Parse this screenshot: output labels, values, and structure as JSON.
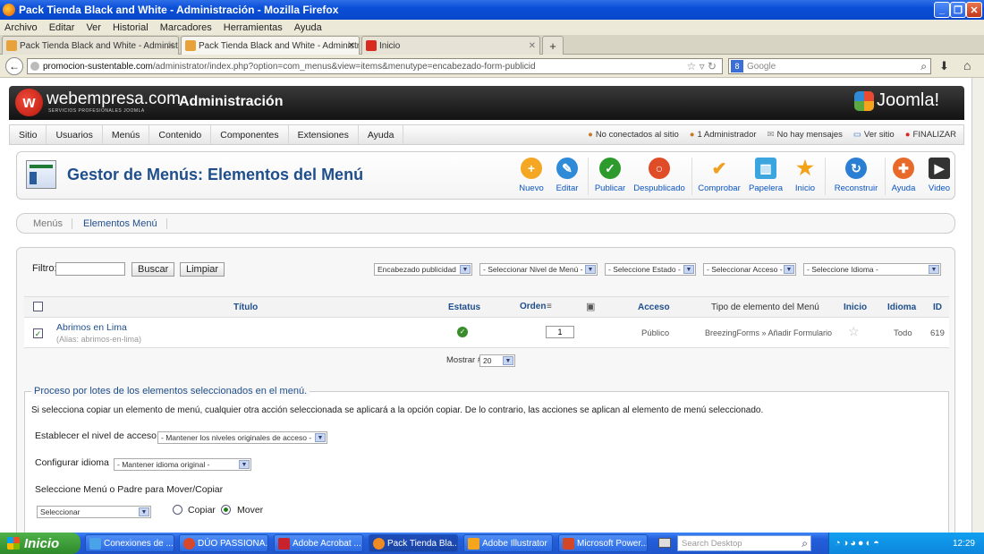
{
  "window": {
    "title": "Pack Tienda Black and White - Administración - Mozilla Firefox"
  },
  "menubar": [
    "Archivo",
    "Editar",
    "Ver",
    "Historial",
    "Marcadores",
    "Herramientas",
    "Ayuda"
  ],
  "tabs": [
    {
      "label": "Pack Tienda Black and White - Administra...",
      "active": false
    },
    {
      "label": "Pack Tienda Black and White - Administra...",
      "active": true
    },
    {
      "label": "Inicio",
      "active": false
    }
  ],
  "nav": {
    "url_domain": "promocion-sustentable.com",
    "url_path": "/administrator/index.php?option=com_menus&view=items&menutype=encabezado-form-publicid",
    "search_placeholder": "Google"
  },
  "joomla": {
    "brand": "webempresa.com",
    "brand_tagline": "SERVICIOS PROFESIONALES JOOMLA",
    "admin_title": "Administración",
    "joomla_logo": "Joomla!",
    "main_menu": [
      "Sitio",
      "Usuarios",
      "Menús",
      "Contenido",
      "Componentes",
      "Extensiones",
      "Ayuda"
    ],
    "status": {
      "not_connected": "No conectados al sitio",
      "admin": "1 Administrador",
      "messages": "No hay mensajes",
      "view_site": "Ver sitio",
      "logout": "FINALIZAR"
    },
    "page_title": "Gestor de Menús: Elementos del Menú",
    "toolbar": [
      {
        "label": "Nuevo",
        "color": "#f5a623",
        "icon": "plus-icon"
      },
      {
        "label": "Editar",
        "color": "#2f8ad8",
        "icon": "pencil-icon"
      },
      {
        "label": "Publicar",
        "color": "#2d9a2d",
        "icon": "check-icon"
      },
      {
        "label": "Despublicado",
        "color": "#e04b28",
        "icon": "unpublish-icon"
      },
      {
        "label": "Comprobar",
        "color": "#f0a020",
        "icon": "checkmark-icon"
      },
      {
        "label": "Papelera",
        "color": "#3ba5e0",
        "icon": "trash-icon"
      },
      {
        "label": "Inicio",
        "color": "#f2a319",
        "icon": "star-icon"
      },
      {
        "label": "Reconstruir",
        "color": "#2a7fd4",
        "icon": "refresh-icon"
      },
      {
        "label": "Ayuda",
        "color": "#e86a2b",
        "icon": "help-icon"
      },
      {
        "label": "Video",
        "color": "#333333",
        "icon": "video-icon"
      }
    ],
    "submenu": [
      "Menús",
      "Elementos Menú"
    ],
    "filter": {
      "label": "Filtro:",
      "value": "",
      "search_btn": "Buscar",
      "clear_btn": "Limpiar",
      "menu_select": "Encabezado publicidad",
      "level_select": "- Seleccionar Nivel de Menú -",
      "state_select": "- Seleccione Estado -",
      "access_select": "- Seleccionar Acceso -",
      "lang_select": "- Seleccione Idioma -"
    },
    "table": {
      "headers": {
        "title": "Título",
        "status": "Estatus",
        "order": "Orden",
        "access": "Acceso",
        "type": "Tipo de elemento del Menú",
        "home": "Inicio",
        "lang": "Idioma",
        "id": "ID"
      },
      "rows": [
        {
          "title": "Abrimos en Lima",
          "alias": "(Alias: abrimos-en-lima)",
          "order": "1",
          "access": "Público",
          "type": "BreezingForms » Añadir Formulario",
          "lang": "Todo",
          "id": "619"
        }
      ],
      "show_label": "Mostrar #",
      "show_value": "20"
    },
    "batch": {
      "legend": "Proceso por lotes de los elementos seleccionados en el menú.",
      "tip": "Si selecciona copiar un elemento de menú, cualquier otra acción seleccionada se aplicará a la opción copiar. De lo contrario, las acciones se aplican al elemento de menú seleccionado.",
      "access_label": "Establecer el nivel de acceso",
      "access_value": "- Mantener los niveles originales de acceso -",
      "lang_label": "Configurar idioma",
      "lang_value": "- Mantener idioma original -",
      "move_label": "Seleccione Menú o Padre para Mover/Copiar",
      "move_value": "Seleccionar",
      "copy_label": "Copiar",
      "move_radio_label": "Mover"
    }
  },
  "taskbar": {
    "start": "Inicio",
    "items": [
      {
        "label": "Conexiones de ...",
        "color": "#4aa3e8"
      },
      {
        "label": "DÚO PASSIONA...",
        "color": "#d9482b"
      },
      {
        "label": "Adobe Acrobat ...",
        "color": "#c8232c"
      },
      {
        "label": "Pack Tienda Bla...",
        "color": "#f08a22"
      },
      {
        "label": "Adobe Illustrator",
        "color": "#f7a51c"
      },
      {
        "label": "Microsoft Power...",
        "color": "#d24726"
      }
    ],
    "search_placeholder": "Search Desktop",
    "clock": "12:29"
  }
}
